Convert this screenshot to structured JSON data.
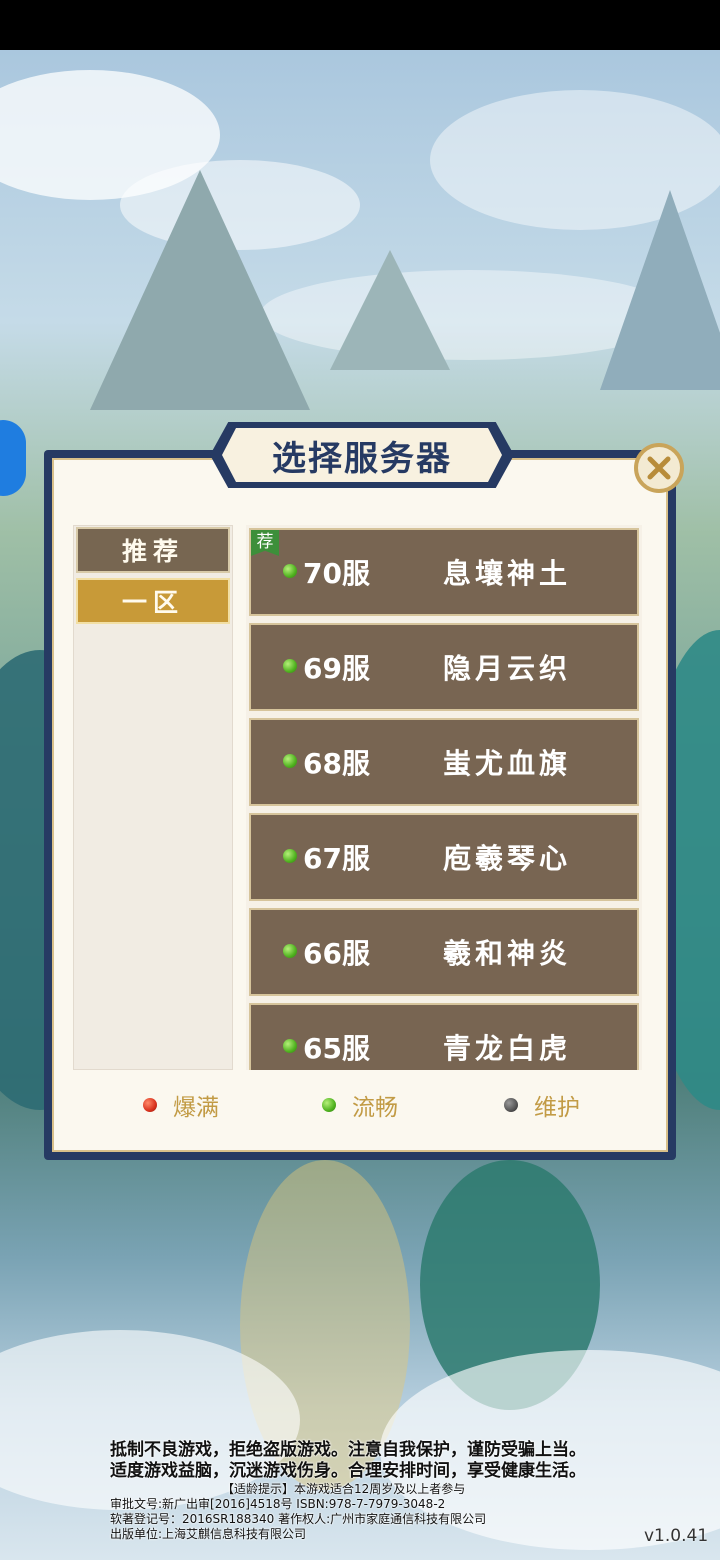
{
  "dialog": {
    "title": "选择服务器",
    "close_icon": "close-x-icon"
  },
  "sidebar": {
    "tabs": [
      {
        "label": "推荐",
        "selected": false
      },
      {
        "label": "一区",
        "selected": true
      }
    ]
  },
  "servers": [
    {
      "number": "70服",
      "name": "息壤神土",
      "status": "green",
      "badge": "荐"
    },
    {
      "number": "69服",
      "name": "隐月云织",
      "status": "green"
    },
    {
      "number": "68服",
      "name": "蚩尤血旗",
      "status": "green"
    },
    {
      "number": "67服",
      "name": "庖羲琴心",
      "status": "green"
    },
    {
      "number": "66服",
      "name": "羲和神炎",
      "status": "green"
    },
    {
      "number": "65服",
      "name": "青龙白虎",
      "status": "green"
    }
  ],
  "legend": [
    {
      "label": "爆满",
      "color": "#d9321e"
    },
    {
      "label": "流畅",
      "color": "#4fb21f"
    },
    {
      "label": "维护",
      "color": "#555555"
    }
  ],
  "footer": {
    "line1": "抵制不良游戏，拒绝盗版游戏。注意自我保护，谨防受骗上当。",
    "line2": "适度游戏益脑，沉迷游戏伤身。合理安排时间，享受健康生活。",
    "line3": "【适龄提示】本游戏适合12周岁及以上者参与",
    "line4": "审批文号:新广出审[2016]4518号   ISBN:978-7-7979-3048-2",
    "line5": "软著登记号：2016SR188340   著作权人:广州市家庭通信科技有限公司",
    "line6": "出版单位:上海艾麒信息科技有限公司"
  },
  "version": "v1.0.41"
}
